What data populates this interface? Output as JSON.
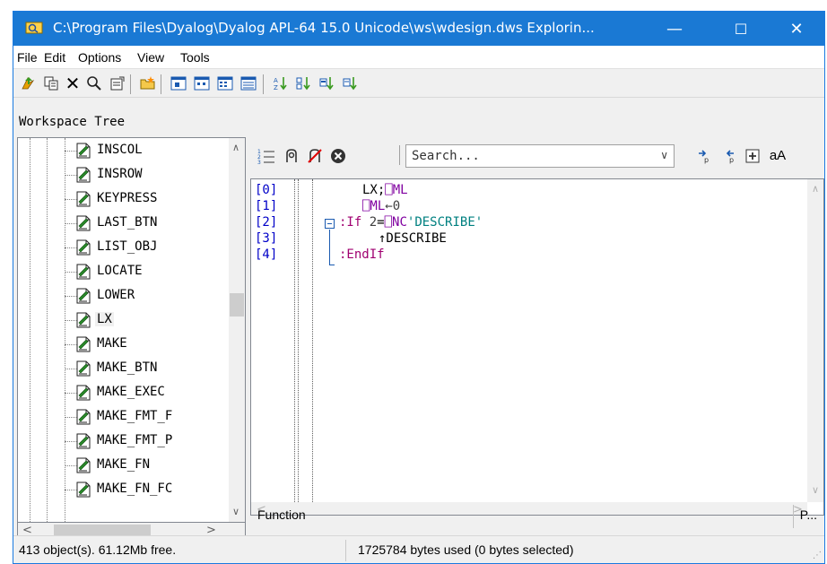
{
  "window": {
    "title": "C:\\Program Files\\Dyalog\\Dyalog APL-64 15.0 Unicode\\ws\\wdesign.dws Explorin...",
    "minimize": "—",
    "maximize": "☐",
    "close": "✕"
  },
  "menu": {
    "items": [
      "File",
      "Edit",
      "Options",
      "View",
      "Tools"
    ]
  },
  "toolbar": {
    "icons": [
      "go-up-icon",
      "copy-icon",
      "delete-icon",
      "find-icon",
      "properties-icon",
      "new-folder-icon",
      "large-icons-icon",
      "small-icons-icon",
      "list-icon",
      "details-icon",
      "sort-name-icon",
      "sort-type-icon",
      "sort-size-icon",
      "sort-date-icon"
    ]
  },
  "workspace_tree": {
    "label": "Workspace Tree",
    "items": [
      "INSCOL",
      "INSROW",
      "KEYPRESS",
      "LAST_BTN",
      "LIST_OBJ",
      "LOCATE",
      "LOWER",
      "LX",
      "MAKE",
      "MAKE_BTN",
      "MAKE_EXEC",
      "MAKE_FMT_F",
      "MAKE_FMT_P",
      "MAKE_FN",
      "MAKE_FN_FC"
    ],
    "selected": "LX"
  },
  "editor_toolbar": {
    "search_placeholder": "Search...",
    "match_case_label": "aA"
  },
  "editor": {
    "line_numbers": [
      "[0]",
      "[1]",
      "[2]",
      "[3]",
      "[4]"
    ],
    "code": {
      "line0_a": "LX;",
      "line0_b": "⎕ML",
      "line1_a": "⎕ML",
      "line1_b": "←0",
      "line2_a": ":If ",
      "line2_b": "2",
      "line2_c": "=",
      "line2_d": "⎕NC",
      "line2_e": "'DESCRIBE'",
      "line3": "↑DESCRIBE",
      "line4": ":EndIf"
    }
  },
  "function_bar": {
    "left": "Function",
    "right": "P..."
  },
  "status": {
    "objects": "413 object(s). 61.12Mb free.",
    "bytes": "1725784 bytes used (0 bytes selected)"
  },
  "colors": {
    "titlebar": "#1a79d4",
    "line_numbers": "#0000c8",
    "keyword": "#a00070",
    "system_name": "#8000a0",
    "string": "#008080"
  }
}
